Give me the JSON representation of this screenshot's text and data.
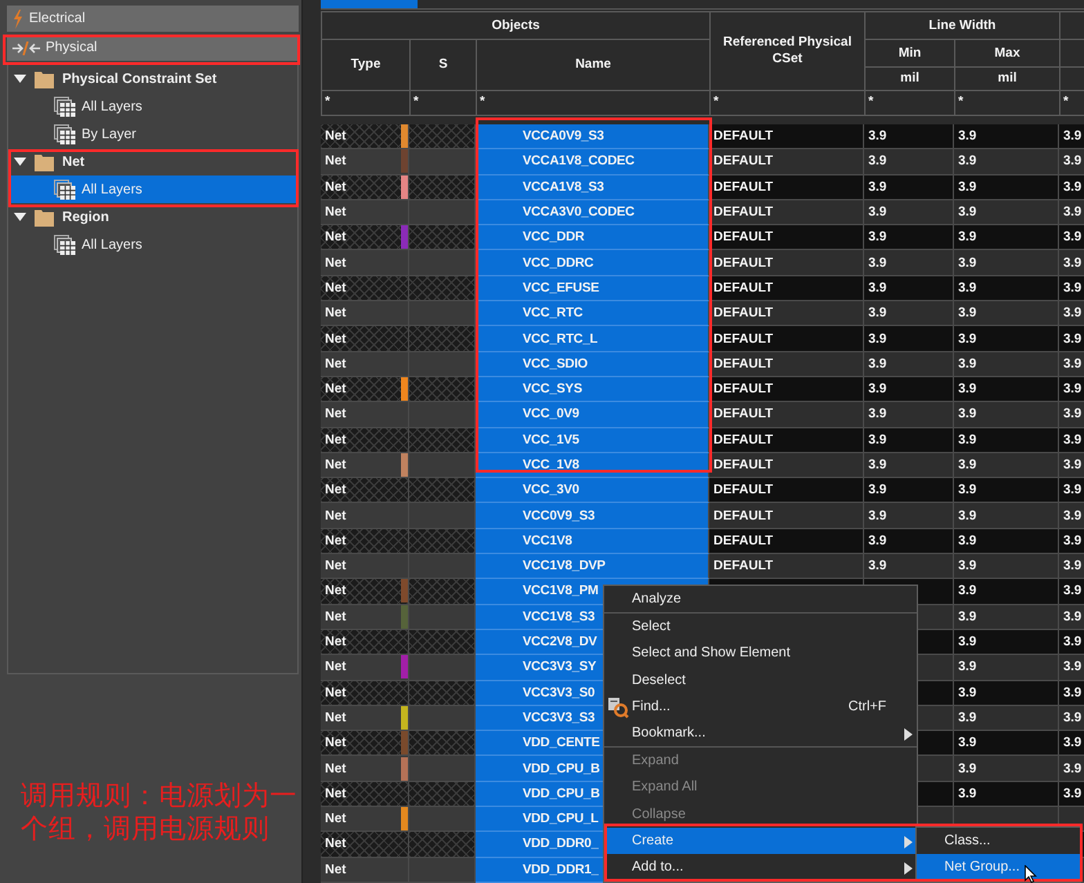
{
  "nav": [
    {
      "label": "Electrical",
      "kind": "electrical"
    },
    {
      "label": "Physical",
      "kind": "physical"
    }
  ],
  "tree": [
    {
      "label": "Physical Constraint Set",
      "expanded": true,
      "children": [
        {
          "label": "All Layers",
          "selected": false
        },
        {
          "label": "By Layer",
          "selected": false
        }
      ]
    },
    {
      "label": "Net",
      "expanded": true,
      "children": [
        {
          "label": "All Layers",
          "selected": true
        }
      ]
    },
    {
      "label": "Region",
      "expanded": true,
      "children": [
        {
          "label": "All Layers",
          "selected": false
        }
      ]
    }
  ],
  "note": "调用规则：电源划为一个组，调用电源规则",
  "table": {
    "headers": {
      "objects": "Objects",
      "type": "Type",
      "s": "S",
      "name": "Name",
      "cset": "Referenced Physical CSet",
      "line_width": "Line Width",
      "min": "Min",
      "max": "Max",
      "min_unit": "mil",
      "max_unit": "mil"
    },
    "filters": [
      "*",
      "*",
      "*",
      "*",
      "*",
      "*",
      "*"
    ],
    "rows": [
      {
        "type": "Net",
        "color": "#e0892f",
        "name": "VCCA0V9_S3",
        "selected": true,
        "cset": "DEFAULT",
        "min": "3.9",
        "max": "3.9",
        "column_7": "3.9"
      },
      {
        "type": "Net",
        "color": "#6e4330",
        "name": "VCCA1V8_CODEC",
        "selected": true,
        "cset": "DEFAULT",
        "min": "3.9",
        "max": "3.9",
        "column_7": "3.9"
      },
      {
        "type": "Net",
        "color": "#e58585",
        "name": "VCCA1V8_S3",
        "selected": true,
        "cset": "DEFAULT",
        "min": "3.9",
        "max": "3.9",
        "column_7": "3.9"
      },
      {
        "type": "Net",
        "name": "VCCA3V0_CODEC",
        "selected": true,
        "cset": "DEFAULT",
        "min": "3.9",
        "max": "3.9",
        "column_7": "3.9"
      },
      {
        "type": "Net",
        "color": "#8b2bb8",
        "name": "VCC_DDR",
        "selected": true,
        "cset": "DEFAULT",
        "min": "3.9",
        "max": "3.9",
        "column_7": "3.9"
      },
      {
        "type": "Net",
        "name": "VCC_DDRC",
        "selected": true,
        "cset": "DEFAULT",
        "min": "3.9",
        "max": "3.9",
        "column_7": "3.9"
      },
      {
        "type": "Net",
        "name": "VCC_EFUSE",
        "selected": true,
        "cset": "DEFAULT",
        "min": "3.9",
        "max": "3.9",
        "column_7": "3.9"
      },
      {
        "type": "Net",
        "name": "VCC_RTC",
        "selected": true,
        "cset": "DEFAULT",
        "min": "3.9",
        "max": "3.9",
        "column_7": "3.9"
      },
      {
        "type": "Net",
        "name": "VCC_RTC_L",
        "selected": true,
        "cset": "DEFAULT",
        "min": "3.9",
        "max": "3.9",
        "column_7": "3.9"
      },
      {
        "type": "Net",
        "name": "VCC_SDIO",
        "selected": true,
        "cset": "DEFAULT",
        "min": "3.9",
        "max": "3.9",
        "column_7": "3.9"
      },
      {
        "type": "Net",
        "color": "#f0861e",
        "name": "VCC_SYS",
        "selected": true,
        "cset": "DEFAULT",
        "min": "3.9",
        "max": "3.9",
        "column_7": "3.9"
      },
      {
        "type": "Net",
        "name": "VCC_0V9",
        "selected": true,
        "cset": "DEFAULT",
        "min": "3.9",
        "max": "3.9",
        "column_7": "3.9"
      },
      {
        "type": "Net",
        "name": "VCC_1V5",
        "selected": true,
        "cset": "DEFAULT",
        "min": "3.9",
        "max": "3.9",
        "column_7": "3.9"
      },
      {
        "type": "Net",
        "color": "#c0825f",
        "name": "VCC_1V8",
        "selected": true,
        "cset": "DEFAULT",
        "min": "3.9",
        "max": "3.9",
        "column_7": "3.9"
      },
      {
        "type": "Net",
        "name": "VCC_3V0",
        "selected": true,
        "cset": "DEFAULT",
        "min": "3.9",
        "max": "3.9",
        "column_7": "3.9"
      },
      {
        "type": "Net",
        "name": "VCC0V9_S3",
        "selected": true,
        "cset": "DEFAULT",
        "min": "3.9",
        "max": "3.9",
        "column_7": "3.9"
      },
      {
        "type": "Net",
        "name": "VCC1V8",
        "selected": true,
        "cset": "DEFAULT",
        "min": "3.9",
        "max": "3.9",
        "column_7": "3.9"
      },
      {
        "type": "Net",
        "name": "VCC1V8_DVP",
        "selected": true,
        "cset": "DEFAULT",
        "min": "3.9",
        "max": "3.9",
        "column_7": "3.9"
      },
      {
        "type": "Net",
        "color": "#7f4a2c",
        "name": "VCC1V8_PM",
        "selected": true,
        "max": "3.9",
        "column_7": "3.9"
      },
      {
        "type": "Net",
        "color": "#56633a",
        "name": "VCC1V8_S3",
        "selected": true,
        "max": "3.9",
        "column_7": "3.9"
      },
      {
        "type": "Net",
        "name": "VCC2V8_DV",
        "selected": true,
        "max": "3.9",
        "column_7": "3.9"
      },
      {
        "type": "Net",
        "color": "#a21fa8",
        "name": "VCC3V3_SY",
        "selected": true,
        "max": "3.9",
        "column_7": "3.9"
      },
      {
        "type": "Net",
        "name": "VCC3V3_S0",
        "selected": true,
        "max": "3.9",
        "column_7": "3.9"
      },
      {
        "type": "Net",
        "color": "#c4b51e",
        "name": "VCC3V3_S3",
        "selected": true,
        "max": "3.9",
        "column_7": "3.9"
      },
      {
        "type": "Net",
        "color": "#7a4a2c",
        "name": "VDD_CENTE",
        "selected": true,
        "max": "3.9",
        "column_7": "3.9"
      },
      {
        "type": "Net",
        "color": "#b57257",
        "name": "VDD_CPU_B",
        "selected": true,
        "max": "3.9",
        "column_7": "3.9"
      },
      {
        "type": "Net",
        "name": "VDD_CPU_B",
        "selected": true,
        "max": "3.9",
        "column_7": "3.9"
      },
      {
        "type": "Net",
        "color": "#e4891f",
        "name": "VDD_CPU_L",
        "selected": true
      },
      {
        "type": "Net",
        "name": "VDD_DDR0_",
        "selected": true
      },
      {
        "type": "Net",
        "name": "VDD_DDR1_",
        "selected": true
      }
    ]
  },
  "context_menu": {
    "items": [
      {
        "kind": "item",
        "label": "Analyze",
        "disabled": false,
        "selected": false,
        "submenu": false
      },
      {
        "kind": "separator"
      },
      {
        "kind": "item",
        "label": "Select",
        "disabled": false,
        "selected": false,
        "submenu": false
      },
      {
        "kind": "item",
        "label": "Select and Show Element",
        "disabled": false,
        "selected": false,
        "submenu": false
      },
      {
        "kind": "item",
        "label": "Deselect",
        "disabled": false,
        "selected": false,
        "submenu": false
      },
      {
        "kind": "find",
        "label": "Find...",
        "shortcut": "Ctrl+F",
        "disabled": false,
        "selected": false,
        "submenu": false
      },
      {
        "kind": "item",
        "label": "Bookmark...",
        "disabled": false,
        "selected": false,
        "submenu": true
      },
      {
        "kind": "separator"
      },
      {
        "kind": "item",
        "label": "Expand",
        "disabled": true,
        "selected": false,
        "submenu": false
      },
      {
        "kind": "item",
        "label": "Expand All",
        "disabled": true,
        "selected": false,
        "submenu": false
      },
      {
        "kind": "item",
        "label": "Collapse",
        "disabled": true,
        "selected": false,
        "submenu": false
      },
      {
        "kind": "item",
        "label": "Create",
        "disabled": false,
        "selected": true,
        "submenu": true
      },
      {
        "kind": "item",
        "label": "Add to...",
        "disabled": false,
        "selected": false,
        "submenu": true
      }
    ]
  },
  "submenu": {
    "items": [
      {
        "label": "Class...",
        "selected": false
      },
      {
        "label": "Net Group...",
        "selected": true
      }
    ]
  }
}
